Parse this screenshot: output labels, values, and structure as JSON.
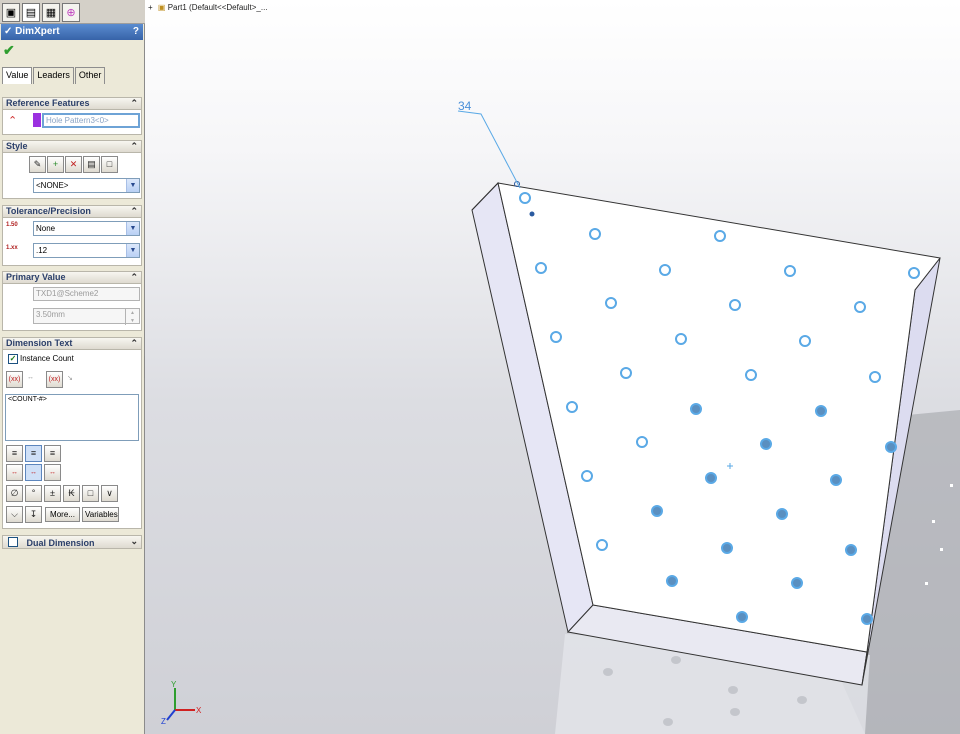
{
  "panel": {
    "title": "DimXpert",
    "help": "?",
    "ok_symbol": "✔",
    "top_tab_icons": [
      "feature-manager-icon",
      "property-manager-icon",
      "configuration-manager-icon",
      "dimxpert-manager-icon"
    ],
    "tabs": [
      "Value",
      "Leaders",
      "Other"
    ],
    "sections": {
      "reference_features": {
        "header": "Reference Features",
        "value": "Hole Pattern3<0>"
      },
      "style": {
        "header": "Style",
        "dropdown_value": "<NONE>"
      },
      "tolerance_precision": {
        "header": "Tolerance/Precision",
        "tolerance_value": "None",
        "precision_value": ".12"
      },
      "primary_value": {
        "header": "Primary Value",
        "reference": "TXD1@Scheme2",
        "value": "3.50mm"
      },
      "dimension_text": {
        "header": "Dimension Text",
        "instance_count_label": "Instance Count",
        "text_value": "<COUNT-#>",
        "more_label": "More...",
        "variables_label": "Variables"
      },
      "dual_dimension": {
        "header": "Dual Dimension"
      }
    }
  },
  "viewport": {
    "tree_label": "Part1  (Default<<Default>_...",
    "callout_text": "34",
    "callout_color": "#4a90d9",
    "triad": {
      "x": "X",
      "y": "Y",
      "z": "Z"
    }
  }
}
